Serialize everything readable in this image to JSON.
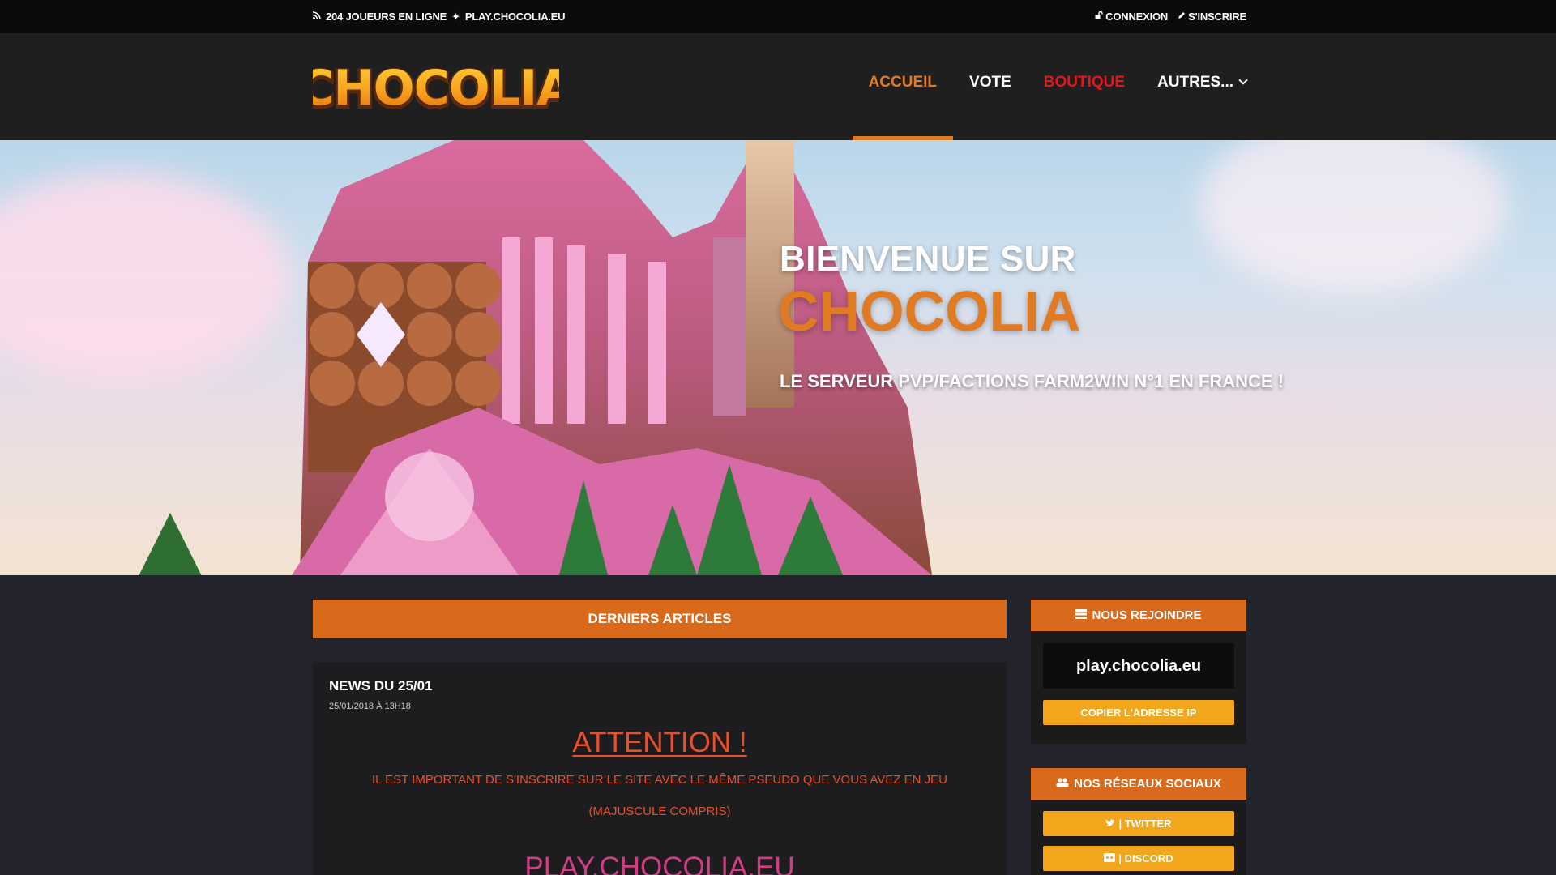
{
  "topbar": {
    "players_online": "204 JOUEURS EN LIGNE",
    "separator": "✦",
    "server_address": "PLAY.CHOCOLIA.EU",
    "login_label": "CONNEXION",
    "register_label": "S'INSCRIRE"
  },
  "nav": {
    "logo_text": "CHOCOLIA",
    "items": [
      {
        "label": "ACCUEIL"
      },
      {
        "label": "VOTE"
      },
      {
        "label": "BOUTIQUE"
      },
      {
        "label": "AUTRES..."
      }
    ]
  },
  "hero": {
    "line1": "BIENVENUE SUR",
    "line2": "CHOCOLIA",
    "tagline": "LE SERVEUR PVP/FACTIONS FARM2WIN N°1 EN FRANCE !"
  },
  "main": {
    "section_title": "DERNIERS ARTICLES",
    "article": {
      "title": "NEWS DU 25/01",
      "date": "25/01/2018 À 13H18",
      "heading": "ATTENTION !",
      "para1": "IL EST IMPORTANT DE S'INSCRIRE SUR LE SITE AVEC LE MÊME PSEUDO QUE VOUS AVEZ EN JEU",
      "para2": "(MAJUSCULE COMPRIS)",
      "footer_heading": "PLAY.CHOCOLIA.EU"
    }
  },
  "sidebar": {
    "join": {
      "title": "NOUS REJOINDRE",
      "ip": "play.chocolia.eu",
      "copy_label": "COPIER L'ADRESSE IP"
    },
    "social": {
      "title": "NOS RÉSEAUX SOCIAUX",
      "twitter_label": "| TWITTER",
      "discord_label": "| DISCORD"
    }
  },
  "colors": {
    "accent": "#e07b24",
    "shop": "#e5151b",
    "button": "#f2a61b",
    "alert": "#e8502a"
  }
}
